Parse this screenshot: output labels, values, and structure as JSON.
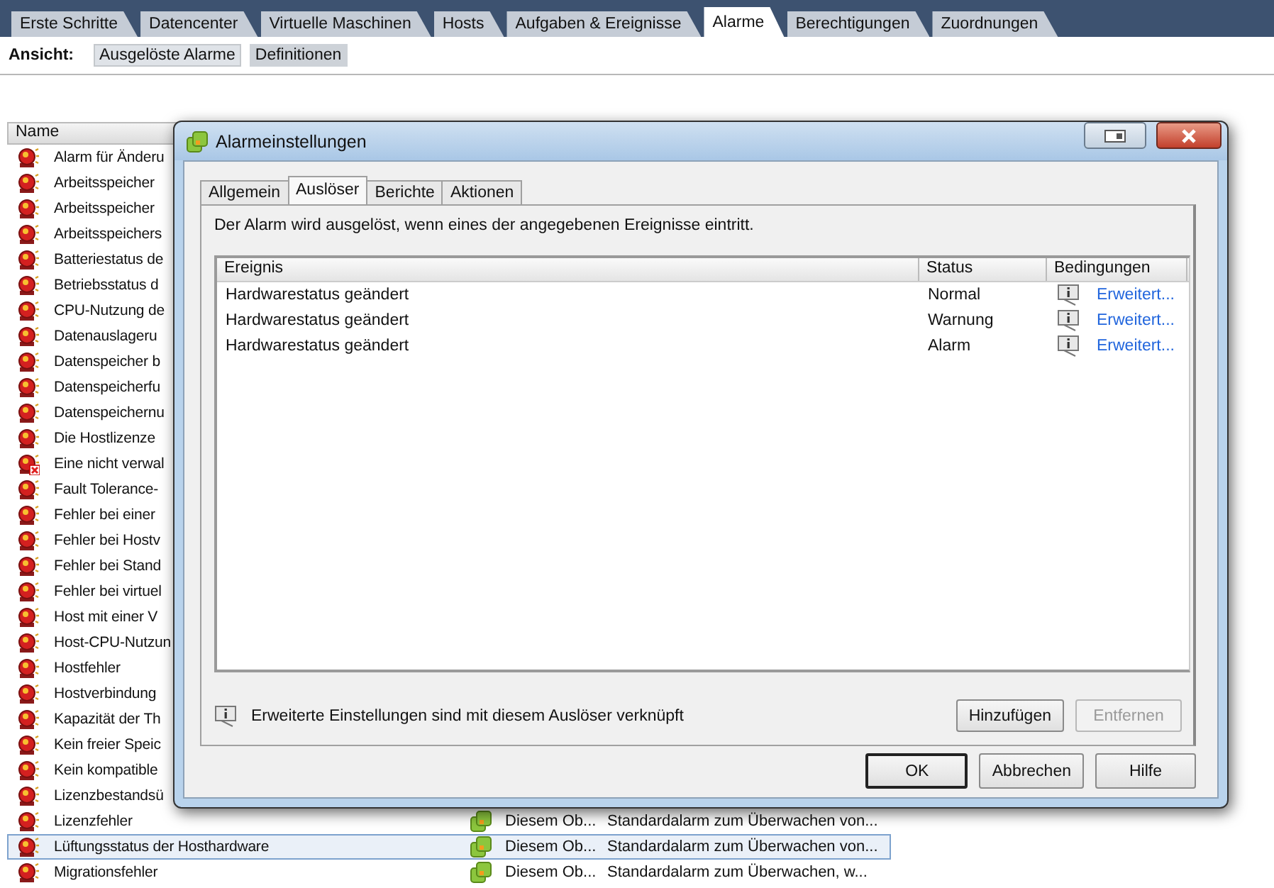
{
  "main_tabs": [
    {
      "label": "Erste Schritte",
      "selected": false
    },
    {
      "label": "Datencenter",
      "selected": false
    },
    {
      "label": "Virtuelle Maschinen",
      "selected": false
    },
    {
      "label": "Hosts",
      "selected": false
    },
    {
      "label": "Aufgaben & Ereignisse",
      "selected": false
    },
    {
      "label": "Alarme",
      "selected": true
    },
    {
      "label": "Berechtigungen",
      "selected": false
    },
    {
      "label": "Zuordnungen",
      "selected": false
    }
  ],
  "view": {
    "label": "Ansicht:",
    "options": [
      {
        "label": "Ausgelöste Alarme",
        "selected": false
      },
      {
        "label": "Definitionen",
        "selected": true
      }
    ]
  },
  "alarm_list": {
    "columns": [
      "Name"
    ],
    "rows": [
      {
        "kind": "alarm",
        "name": "Alarm für Änderu",
        "selected": false
      },
      {
        "kind": "alarm",
        "name": "Arbeitsspeicher",
        "selected": false
      },
      {
        "kind": "alarm",
        "name": "Arbeitsspeicher",
        "selected": false
      },
      {
        "kind": "alarm",
        "name": "Arbeitsspeichers",
        "selected": false
      },
      {
        "kind": "alarm",
        "name": "Batteriestatus de",
        "selected": false
      },
      {
        "kind": "alarm",
        "name": "Betriebsstatus d",
        "selected": false
      },
      {
        "kind": "alarm",
        "name": "CPU-Nutzung de",
        "selected": false
      },
      {
        "kind": "alarm",
        "name": "Datenauslageru",
        "selected": false
      },
      {
        "kind": "alarm",
        "name": "Datenspeicher b",
        "selected": false
      },
      {
        "kind": "alarm",
        "name": "Datenspeicherfu",
        "selected": false
      },
      {
        "kind": "alarm",
        "name": "Datenspeichernu",
        "selected": false
      },
      {
        "kind": "alarm",
        "name": "Die Hostlizenze",
        "selected": false
      },
      {
        "kind": "alarm-error",
        "name": "Eine nicht verwal",
        "selected": false
      },
      {
        "kind": "alarm",
        "name": "Fault Tolerance-",
        "selected": false
      },
      {
        "kind": "alarm",
        "name": "Fehler bei einer",
        "selected": false
      },
      {
        "kind": "alarm",
        "name": "Fehler bei Hostv",
        "selected": false
      },
      {
        "kind": "alarm",
        "name": "Fehler bei Stand",
        "selected": false
      },
      {
        "kind": "alarm",
        "name": "Fehler bei virtuel",
        "selected": false
      },
      {
        "kind": "alarm",
        "name": "Host mit einer V",
        "selected": false
      },
      {
        "kind": "alarm",
        "name": "Host-CPU-Nutzun",
        "selected": false
      },
      {
        "kind": "alarm",
        "name": "Hostfehler",
        "selected": false
      },
      {
        "kind": "alarm",
        "name": "Hostverbindung",
        "selected": false
      },
      {
        "kind": "alarm",
        "name": "Kapazität der Th",
        "selected": false
      },
      {
        "kind": "alarm",
        "name": "Kein freier Speic",
        "selected": false
      },
      {
        "kind": "alarm",
        "name": "Kein kompatible",
        "selected": false
      },
      {
        "kind": "alarm",
        "name": "Lizenzbestandsü",
        "selected": false
      },
      {
        "kind": "alarm",
        "name": "Lizenzfehler",
        "selected": false,
        "column_2": "Diesem Ob...",
        "column_3": "Standardalarm zum Überwachen von..."
      },
      {
        "kind": "alarm",
        "name": "Lüftungsstatus der Hosthardware",
        "selected": true,
        "column_2": "Diesem Ob...",
        "column_3": "Standardalarm zum Überwachen von..."
      },
      {
        "kind": "alarm",
        "name": "Migrationsfehler",
        "selected": false,
        "column_2": "Diesem Ob...",
        "column_3": "Standardalarm zum Überwachen, w..."
      }
    ]
  },
  "dialog": {
    "title": "Alarmeinstellungen",
    "tabs": [
      {
        "label": "Allgemein",
        "selected": false
      },
      {
        "label": "Auslöser",
        "selected": true
      },
      {
        "label": "Berichte",
        "selected": false
      },
      {
        "label": "Aktionen",
        "selected": false
      }
    ],
    "description": "Der Alarm wird ausgelöst, wenn eines der angegebenen Ereignisse eintritt.",
    "table": {
      "columns": [
        "Ereignis",
        "Status",
        "Bedingungen"
      ],
      "rows": [
        {
          "event": "Hardwarestatus geändert",
          "status": "Normal",
          "condition": "Erweitert..."
        },
        {
          "event": "Hardwarestatus geändert",
          "status": "Warnung",
          "condition": "Erweitert..."
        },
        {
          "event": "Hardwarestatus geändert",
          "status": "Alarm",
          "condition": "Erweitert..."
        }
      ]
    },
    "info_text": "Erweiterte Einstellungen sind mit diesem Auslöser verknüpft",
    "table_buttons": [
      {
        "label": "Hinzufügen",
        "disabled": false
      },
      {
        "label": "Entfernen",
        "disabled": true
      }
    ],
    "footer_buttons": [
      {
        "label": "OK",
        "default": true
      },
      {
        "label": "Abbrechen",
        "default": false
      },
      {
        "label": "Hilfe",
        "default": false
      }
    ]
  }
}
